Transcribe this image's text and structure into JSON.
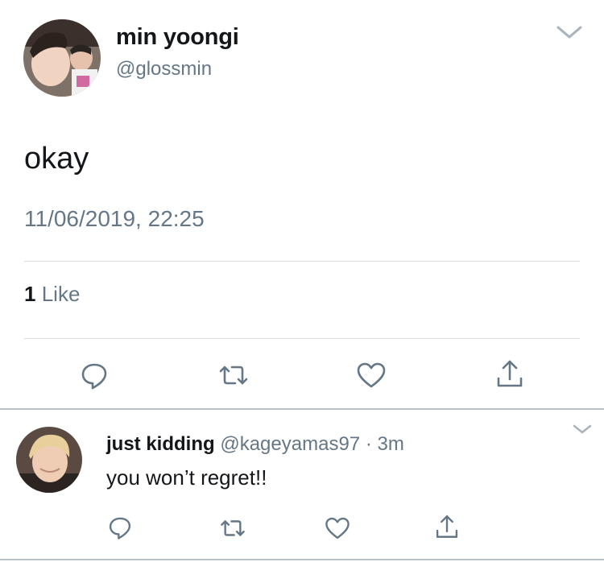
{
  "main_tweet": {
    "display_name": "min yoongi",
    "handle": "@glossmin",
    "text": "okay",
    "timestamp": "11/06/2019, 22:25",
    "likes_count": "1",
    "likes_label": "Like",
    "avatar_icon": "profile-photo"
  },
  "reply": {
    "display_name": "just kidding",
    "handle": "@kageyamas97",
    "separator": "·",
    "age": "3m",
    "text": "you won’t regret!!",
    "avatar_icon": "profile-photo"
  },
  "colors": {
    "text_primary": "#14171a",
    "text_secondary": "#657786",
    "divider": "#d9dde1"
  }
}
